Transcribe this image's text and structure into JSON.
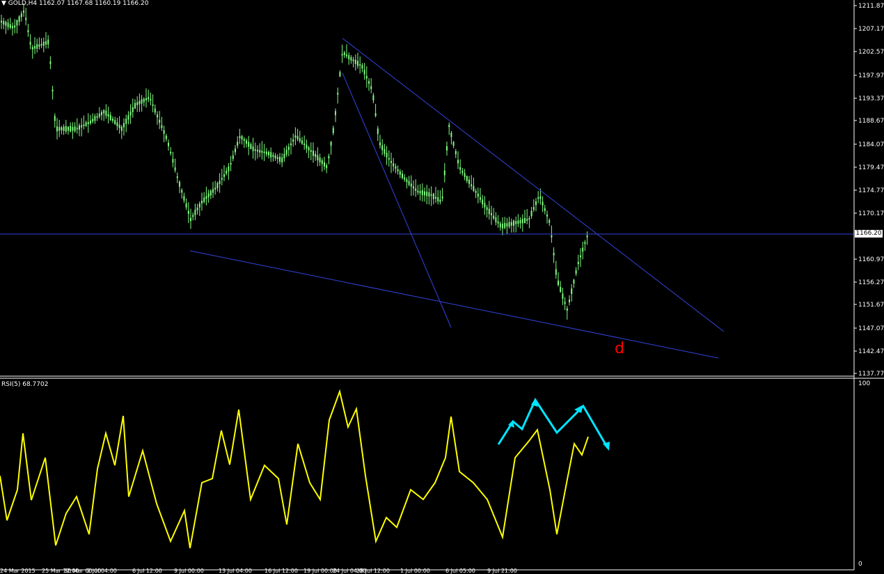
{
  "main_window": {
    "header": "▼ GOLD,H4  1162.07 1167.68 1160.19 1166.20",
    "price_axis_labels": [
      "1211.87",
      "1207.17",
      "1202.57",
      "1197.97",
      "1193.37",
      "1188.67",
      "1184.07",
      "1179.47",
      "1174.77",
      "1170.17",
      "1160.97",
      "1156.27",
      "1151.67",
      "1147.07",
      "1142.47",
      "1137.77"
    ],
    "current_price": "1166.20",
    "annotation_label": "d"
  },
  "rsi_window": {
    "header": "RSI(5) 68.7702",
    "scale_max": "100",
    "scale_min": "0"
  },
  "time_axis_labels": [
    "24 Mar 2015",
    "25 Mar 12:00",
    "30 Mar 00:00",
    "2 Jul 04:00",
    "6 Jul 12:00",
    "9 Jul 00:00",
    "13 Jul 04:00",
    "16 Jul 12:00",
    "19 Jul 00:00",
    "24 Jul 04:00",
    "28 Jul 12:00",
    "1 Jul 00:00",
    "6 Jul 05:00",
    "9 Jul 21:00"
  ],
  "colors": {
    "background": "#000000",
    "candles": "#7fff7f",
    "trendlines": "#3344dd",
    "rsi_line": "#ffff00",
    "arrows": "#00e5ff",
    "annotation": "#ff0000",
    "axis": "#ffffff"
  },
  "icons": [
    "dropdown-triangle-icon"
  ]
}
